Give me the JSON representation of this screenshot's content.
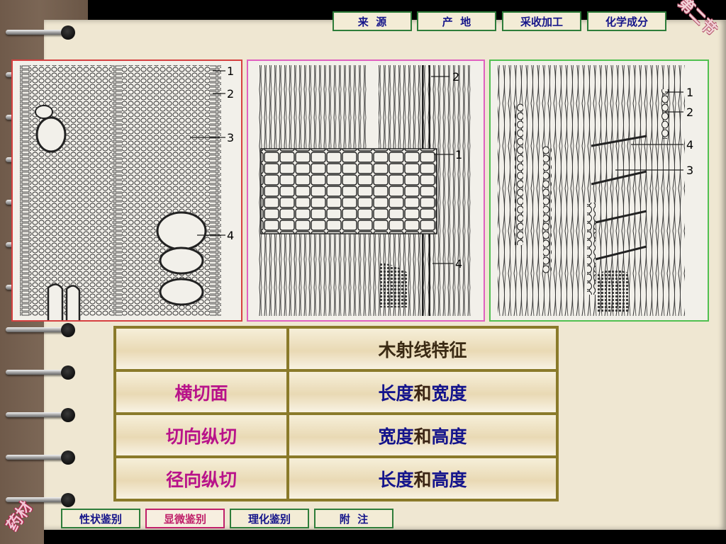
{
  "nav_top": [
    {
      "label": "来  源"
    },
    {
      "label": "产  地"
    },
    {
      "label": "采收加工"
    },
    {
      "label": "化学成分"
    }
  ],
  "nav_bottom": [
    {
      "label": "性状鉴别",
      "active": false
    },
    {
      "label": "显微鉴别",
      "active": true
    },
    {
      "label": "理化鉴别",
      "active": false
    },
    {
      "label": "附  注",
      "active": false
    }
  ],
  "corner_top": "第二节",
  "corner_bottom": "药材",
  "figures": [
    {
      "labels": [
        "1",
        "2",
        "3",
        "4"
      ]
    },
    {
      "labels": [
        "2",
        "1",
        "4"
      ]
    },
    {
      "labels": [
        "1",
        "2",
        "4",
        "3"
      ]
    }
  ],
  "table": {
    "header": [
      "",
      "木射线特征"
    ],
    "rows": [
      {
        "label": "横切面",
        "value_a": "长度",
        "conj": "和",
        "value_b": "宽度"
      },
      {
        "label": "切向纵切",
        "value_a": "宽度",
        "conj": "和",
        "value_b": "高度"
      },
      {
        "label": "径向纵切",
        "value_a": "长度",
        "conj": "和",
        "value_b": "高度"
      }
    ]
  },
  "colors": {
    "nav_border": "#2e7d3a",
    "active_nav": "#c0206a",
    "row_label": "#b8128a",
    "value_blue": "#14148c",
    "fig1_border": "#d64040",
    "fig2_border": "#e060c0",
    "fig3_border": "#50c050"
  }
}
